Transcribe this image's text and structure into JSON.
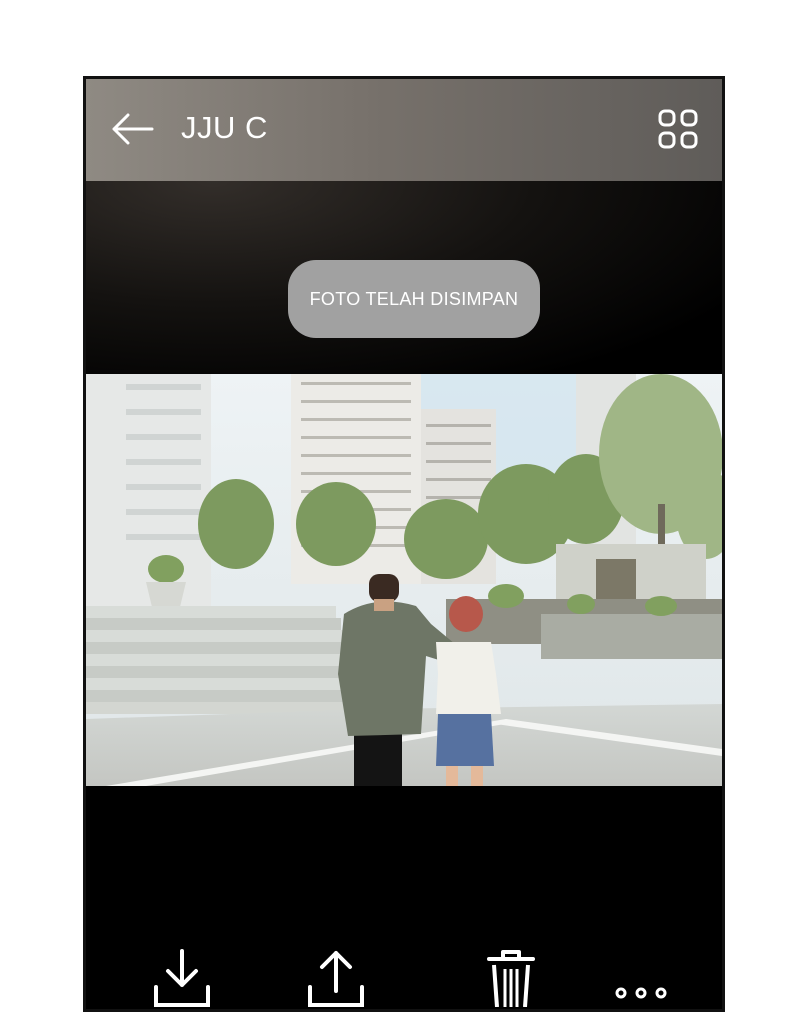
{
  "header": {
    "title": "JJU C",
    "back_icon": "arrow-left-icon",
    "gallery_icon": "grid-icon"
  },
  "toast": {
    "message": "FOTO TELAH DISIMPAN"
  },
  "toolbar": {
    "items": [
      {
        "icon": "download-icon"
      },
      {
        "icon": "share-icon"
      },
      {
        "icon": "trash-icon"
      },
      {
        "icon": "more-icon"
      }
    ]
  },
  "colors": {
    "topbar": "#7a756f",
    "toast_bg": "#a1a1a1",
    "background": "#000000",
    "frame": "#ffffff"
  }
}
